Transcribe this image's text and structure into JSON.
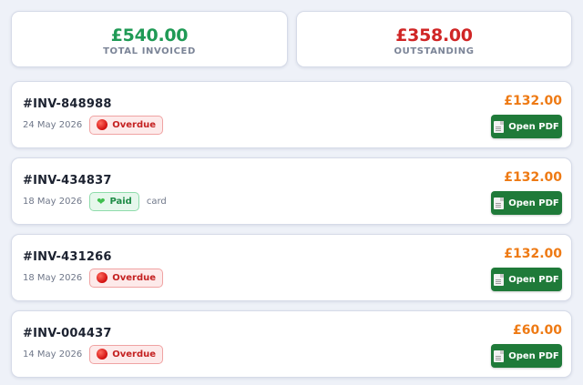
{
  "summary": {
    "total_invoiced": {
      "amount": "£540.00",
      "label": "TOTAL INVOICED",
      "color": "#1f9a55"
    },
    "outstanding": {
      "amount": "£358.00",
      "label": "OUTSTANDING",
      "color": "#d02525"
    }
  },
  "colors": {
    "amount_orange": "#ee7a14",
    "pdf_button_green": "#1f7a39",
    "overdue_red": "#c42121",
    "paid_green": "#1e8b46"
  },
  "invoices": [
    {
      "id": "#INV-848988",
      "date": "24 May 2026",
      "status": "Overdue",
      "status_icon": "red-circle-icon",
      "method": "",
      "amount": "£132.00",
      "button_label": "Open PDF"
    },
    {
      "id": "#INV-434837",
      "date": "18 May 2026",
      "status": "Paid",
      "status_icon": "green-heart-icon",
      "method": "card",
      "amount": "£132.00",
      "button_label": "Open PDF"
    },
    {
      "id": "#INV-431266",
      "date": "18 May 2026",
      "status": "Overdue",
      "status_icon": "red-circle-icon",
      "method": "",
      "amount": "£132.00",
      "button_label": "Open PDF"
    },
    {
      "id": "#INV-004437",
      "date": "14 May 2026",
      "status": "Overdue",
      "status_icon": "red-circle-icon",
      "method": "",
      "amount": "£60.00",
      "button_label": "Open PDF"
    }
  ]
}
